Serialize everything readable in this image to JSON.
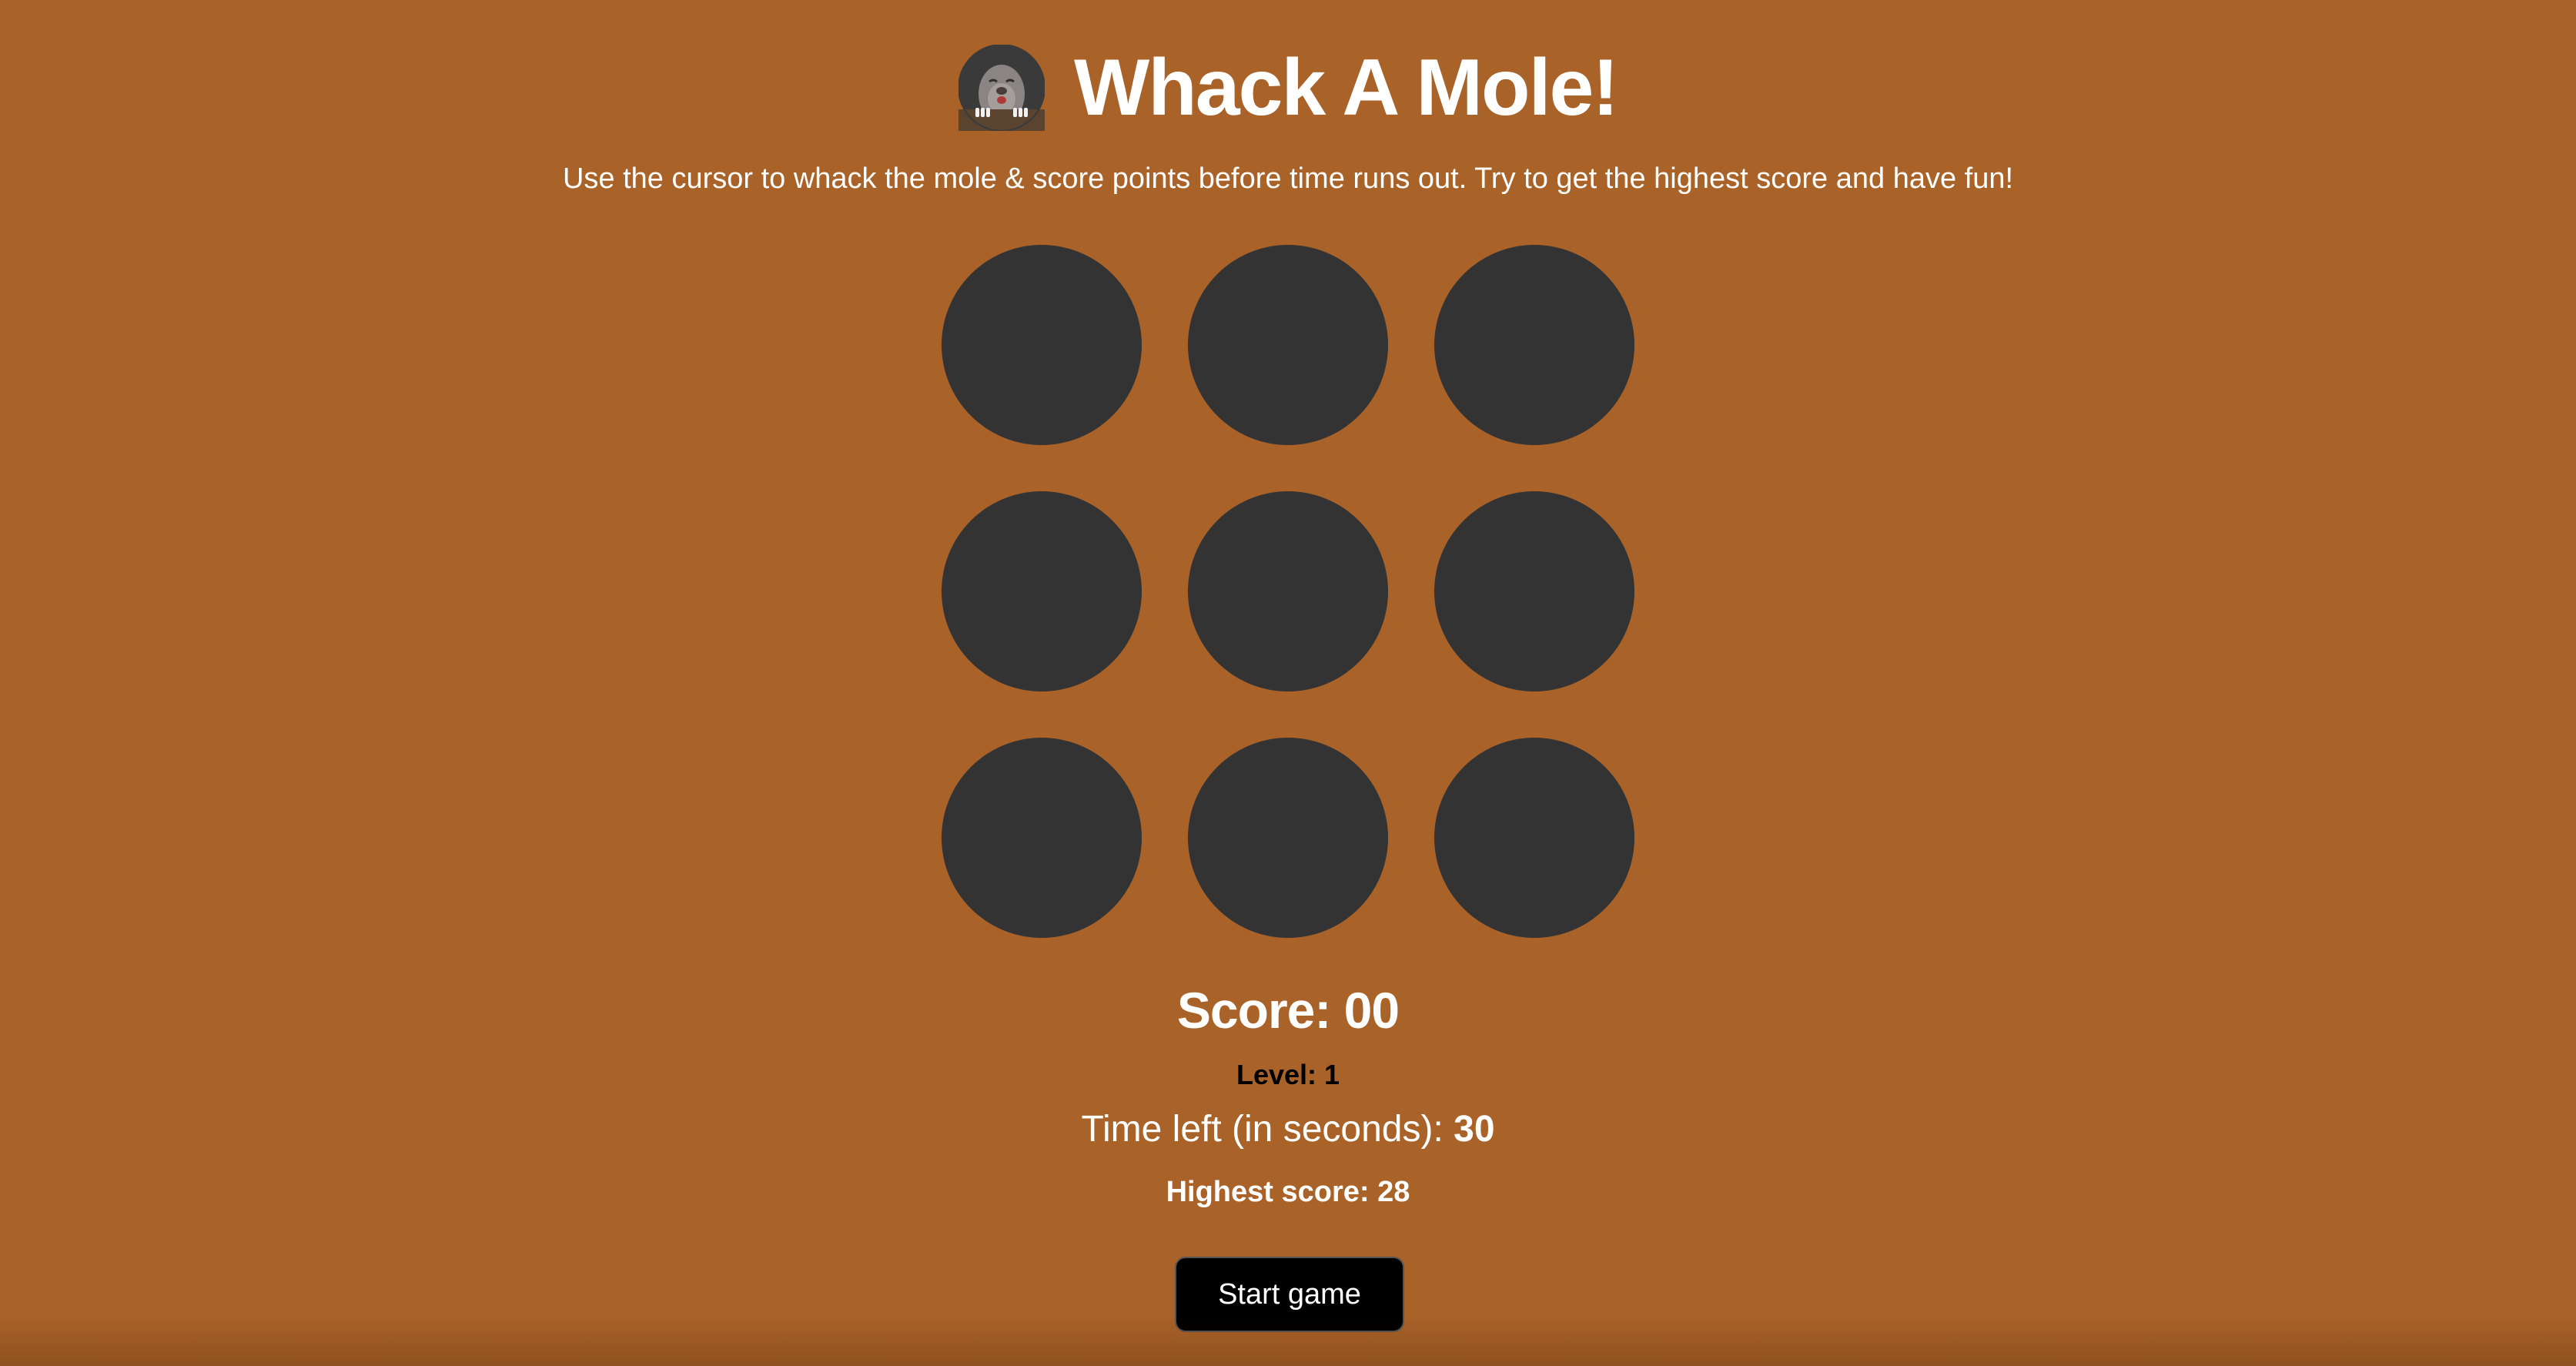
{
  "app": {
    "title": "Whack A Mole!",
    "logo_icon": "mole-icon",
    "instructions": "Use the cursor to whack the mole & score points before time runs out. Try to get the highest score and have fun!"
  },
  "board": {
    "rows": 3,
    "columns": 3,
    "holes": [
      "",
      "",
      "",
      "",
      "",
      "",
      "",
      "",
      ""
    ],
    "hole_color": "#333333"
  },
  "stats": {
    "score_label": "Score:",
    "score_value": "00",
    "level_label": "Level:",
    "level_value": "1",
    "time_label": "Time left (in seconds):",
    "time_value": "30",
    "highest_label": "Highest score:",
    "highest_value": "28"
  },
  "controls": {
    "start_label": "Start game"
  },
  "colors": {
    "background": "#a96228",
    "text": "#ffffff",
    "level_text": "#000000",
    "button_bg": "#000000"
  }
}
